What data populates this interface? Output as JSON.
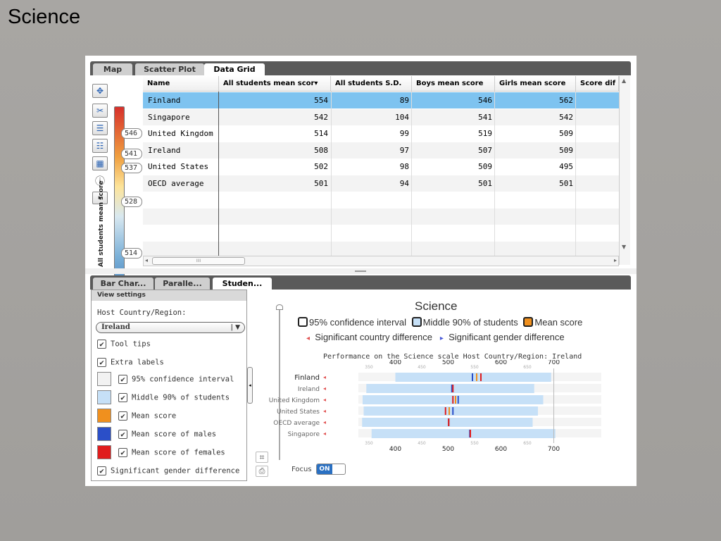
{
  "slide": {
    "title": "Science"
  },
  "top_tabs": [
    "Map",
    "Scatter Plot",
    "Data Grid"
  ],
  "grid": {
    "columns": [
      "Name",
      "All students mean scor▾",
      "All students S.D.",
      "Boys mean score",
      "Girls mean score",
      "Score dif"
    ],
    "rows": [
      [
        "Finland",
        "554",
        "89",
        "546",
        "562"
      ],
      [
        "Singapore",
        "542",
        "104",
        "541",
        "542"
      ],
      [
        "United Kingdom",
        "514",
        "99",
        "519",
        "509"
      ],
      [
        "Ireland",
        "508",
        "97",
        "507",
        "509"
      ],
      [
        "United States",
        "502",
        "98",
        "509",
        "495"
      ],
      [
        "OECD average",
        "501",
        "94",
        "501",
        "501"
      ]
    ],
    "hscroll_thumb": "IIII"
  },
  "color_legend": {
    "label": "All students mean score",
    "ticks": [
      "546",
      "541",
      "537",
      "528",
      "514"
    ]
  },
  "bottom_tabs": [
    "Bar Char...",
    "Paralle...",
    "Studen..."
  ],
  "settings": {
    "title": "View settings",
    "host_label": "Host Country/Region:",
    "host_value": "Ireland",
    "tool_tips": "Tool tips",
    "extra_labels": "Extra labels",
    "ci": "95% confidence interval",
    "middle90": "Middle 90% of students",
    "mean": "Mean score",
    "males": "Mean score of males",
    "females": "Mean score of females",
    "gender_diff": "Significant gender difference"
  },
  "chart": {
    "title": "Science",
    "legend_ci": "95% confidence interval",
    "legend_mid": "Middle 90% of students",
    "legend_mean": "Mean score",
    "legend_country": "Significant country difference",
    "legend_gender": "Significant gender difference",
    "subtitle": "Performance on the Science scale   Host Country/Region: Ireland",
    "focus_label": "Focus",
    "focus_toggle": "ON",
    "colors": {
      "middle90": "#c6e0f7",
      "mean": "#f0901e",
      "male": "#2b4fc8",
      "female": "#e01c1c"
    }
  },
  "chart_data": {
    "type": "bar",
    "title": "Science",
    "x_major_ticks": [
      "400",
      "500",
      "600",
      "700"
    ],
    "x_minor_ticks": [
      "350",
      "450",
      "550",
      "650"
    ],
    "xlim": [
      330,
      750
    ],
    "categories": [
      "Finland",
      "Ireland",
      "United Kingdom",
      "United States",
      "OECD average",
      "Singapore"
    ],
    "series": [
      {
        "name": "Middle 90% of students",
        "low": [
          400,
          345,
          338,
          340,
          337,
          355
        ],
        "high": [
          695,
          663,
          680,
          670,
          660,
          703
        ]
      },
      {
        "name": "Mean score",
        "values": [
          554,
          508,
          514,
          502,
          501,
          542
        ]
      },
      {
        "name": "Mean score of males",
        "values": [
          546,
          507,
          519,
          509,
          501,
          541
        ]
      },
      {
        "name": "Mean score of females",
        "values": [
          562,
          509,
          509,
          495,
          501,
          542
        ]
      }
    ]
  }
}
